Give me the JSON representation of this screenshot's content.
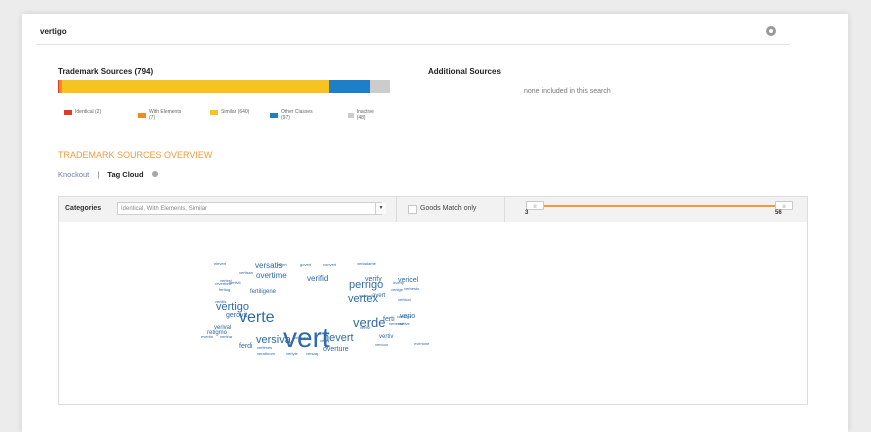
{
  "search": {
    "query": "vertigo"
  },
  "trademark_sources": {
    "title": "Trademark Sources (794)",
    "breakdown": [
      {
        "label": "Identical (2)",
        "count": 2,
        "color": "#e23a27"
      },
      {
        "label": "With Elements (7)",
        "count": 7,
        "color": "#f28a1f"
      },
      {
        "label": "Similar (640)",
        "count": 640,
        "color": "#f7c320"
      },
      {
        "label": "Other Classes (97)",
        "count": 97,
        "color": "#1e7fc9"
      },
      {
        "label": "Inactive (48)",
        "count": 48,
        "color": "#cccccc"
      }
    ]
  },
  "additional_sources": {
    "title": "Additional Sources",
    "empty_text": "none included in this search"
  },
  "overview": {
    "title": "TRADEMARK SOURCES OVERVIEW",
    "tabs": [
      {
        "label": "Knockout",
        "active": false
      },
      {
        "label": "Tag Cloud",
        "active": true
      }
    ],
    "separator": "|"
  },
  "filters": {
    "categories_label": "Categories",
    "categories_value": "Identical, With Elements, Similar",
    "goods_match_label": "Goods Match only",
    "goods_match_checked": false,
    "range_min": "3",
    "range_max": "56",
    "handle_min_label": "|||",
    "handle_max_label": "|||"
  },
  "tag_cloud": [
    {
      "word": "vert",
      "size": 28
    },
    {
      "word": "verte",
      "size": 16
    },
    {
      "word": "verde",
      "size": 13
    },
    {
      "word": "perrigo",
      "size": 11
    },
    {
      "word": "vertex",
      "size": 11
    },
    {
      "word": "vertigo",
      "size": 11
    },
    {
      "word": "versiva",
      "size": 11
    },
    {
      "word": "hevert",
      "size": 11
    },
    {
      "word": "versatis",
      "size": 8
    },
    {
      "word": "overtime",
      "size": 8
    },
    {
      "word": "verifid",
      "size": 8
    },
    {
      "word": "verify",
      "size": 7
    },
    {
      "word": "vericel",
      "size": 7
    },
    {
      "word": "gerovit",
      "size": 7
    },
    {
      "word": "fertiligene",
      "size": 6
    },
    {
      "word": "ferti",
      "size": 7
    },
    {
      "word": "verio",
      "size": 7
    },
    {
      "word": "verival",
      "size": 6
    },
    {
      "word": "retigmo",
      "size": 6
    },
    {
      "word": "ferdi",
      "size": 7
    },
    {
      "word": "overture",
      "size": 7
    },
    {
      "word": "vertiv",
      "size": 6
    },
    {
      "word": "avert",
      "size": 6
    },
    {
      "word": "elevert",
      "size": 4
    },
    {
      "word": "bivert",
      "size": 4
    },
    {
      "word": "govert",
      "size": 4
    },
    {
      "word": "convert",
      "size": 4
    },
    {
      "word": "vertadame",
      "size": 4
    },
    {
      "word": "vertisan",
      "size": 4
    },
    {
      "word": "revertime",
      "size": 4
    },
    {
      "word": "vertesi",
      "size": 4
    },
    {
      "word": "vertivit",
      "size": 4
    },
    {
      "word": "fertiog",
      "size": 4
    },
    {
      "word": "vertilis",
      "size": 4
    },
    {
      "word": "overty",
      "size": 4
    },
    {
      "word": "vertisol",
      "size": 4
    },
    {
      "word": "vertical",
      "size": 4
    },
    {
      "word": "vertige",
      "size": 4
    },
    {
      "word": "verbesto",
      "size": 4
    },
    {
      "word": "vertivi",
      "size": 4
    },
    {
      "word": "vertive",
      "size": 4
    },
    {
      "word": "vertingo",
      "size": 4
    },
    {
      "word": "vertesse",
      "size": 4
    },
    {
      "word": "evertin",
      "size": 4
    },
    {
      "word": "vertina",
      "size": 4
    },
    {
      "word": "vertineo",
      "size": 4
    },
    {
      "word": "verity",
      "size": 4
    },
    {
      "word": "vericon",
      "size": 4
    },
    {
      "word": "everlone",
      "size": 4
    },
    {
      "word": "vertimes",
      "size": 4
    },
    {
      "word": "vertyle",
      "size": 4
    },
    {
      "word": "versaq",
      "size": 4
    },
    {
      "word": "verathrom",
      "size": 4
    }
  ]
}
